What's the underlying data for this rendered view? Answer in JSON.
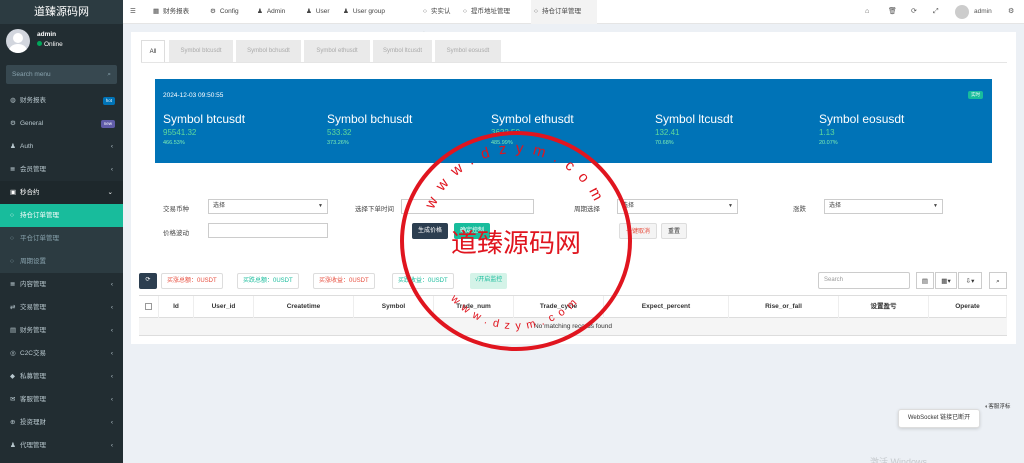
{
  "logo": "道臻源码网",
  "user": {
    "name": "admin",
    "status": "Online"
  },
  "search": {
    "placeholder": "Search menu"
  },
  "menu": [
    {
      "icon": "dashboard-icon",
      "label": "财务报表",
      "badge": "hot",
      "badge_color": "#0073b7",
      "state": "normal"
    },
    {
      "icon": "cogs-icon",
      "label": "General",
      "badge": "new",
      "badge_color": "#605ca8",
      "state": "normal"
    },
    {
      "icon": "group-icon",
      "label": "Auth",
      "arrow": "‹",
      "state": "normal"
    },
    {
      "icon": "list-icon",
      "label": "会员管理",
      "arrow": "‹",
      "state": "normal"
    },
    {
      "icon": "calendar-icon",
      "label": "秒合约",
      "arrow": "⌄",
      "state": "open"
    },
    {
      "icon": "circle-icon",
      "label": "持仓订单管理",
      "state": "active"
    },
    {
      "icon": "circle-icon",
      "label": "平仓订单管理",
      "state": "sub"
    },
    {
      "icon": "circle-icon",
      "label": "周期设置",
      "state": "sub"
    },
    {
      "icon": "list-icon",
      "label": "内容管理",
      "arrow": "‹",
      "state": "normal"
    },
    {
      "icon": "exchange-icon",
      "label": "交易管理",
      "arrow": "‹",
      "state": "normal"
    },
    {
      "icon": "file-icon",
      "label": "财务管理",
      "arrow": "‹",
      "state": "normal"
    },
    {
      "icon": "globe-icon",
      "label": "C2C交易",
      "arrow": "‹",
      "state": "normal"
    },
    {
      "icon": "diamond-icon",
      "label": "私募管理",
      "arrow": "‹",
      "state": "normal"
    },
    {
      "icon": "chat-icon",
      "label": "客服管理",
      "arrow": "‹",
      "state": "normal"
    },
    {
      "icon": "plus-circle-icon",
      "label": "投资理财",
      "arrow": "‹",
      "state": "normal"
    },
    {
      "icon": "users-icon",
      "label": "代理管理",
      "arrow": "‹",
      "state": "normal"
    }
  ],
  "topnav": [
    {
      "icon": "☰",
      "label": ""
    },
    {
      "icon": "▦",
      "label": "财务报表"
    },
    {
      "icon": "⚙",
      "label": "Config"
    },
    {
      "icon": "♟",
      "label": "Admin"
    },
    {
      "icon": "♟",
      "label": "User"
    },
    {
      "icon": "♟",
      "label": "User group"
    },
    {
      "icon": "○",
      "label": "实实认证"
    },
    {
      "icon": "○",
      "label": "提币地址管理"
    },
    {
      "icon": "○",
      "label": "持仓订单管理"
    }
  ],
  "topright": {
    "admin": "admin"
  },
  "tabs": [
    "All",
    "Symbol btcusdt",
    "Symbol bchusdt",
    "Symbol ethusdt",
    "Symbol ltcusdt",
    "Symbol eosusdt"
  ],
  "banner": {
    "date": "2024-12-03 09:50:55",
    "tag": "实时",
    "symbols": [
      {
        "name": "Symbol btcusdt",
        "price": "95541.32",
        "change": "466.53%"
      },
      {
        "name": "Symbol bchusdt",
        "price": "533.32",
        "change": "373.26%"
      },
      {
        "name": "Symbol ethusdt",
        "price": "3623.50",
        "change": "485.99%"
      },
      {
        "name": "Symbol ltcusdt",
        "price": "132.41",
        "change": "70.68%"
      },
      {
        "name": "Symbol eosusdt",
        "price": "1.13",
        "change": "20.07%"
      }
    ]
  },
  "filters": {
    "currency_label": "交易币种",
    "currency_value": "选择",
    "order_time_label": "选择下单时间",
    "period_label": "周期选择",
    "period_value": "选择",
    "rise_fall_label": "涨跌",
    "rise_fall_value": "选择",
    "price_swing_label": "价格波动",
    "btn_generate": "生成价格",
    "btn_control": "确定控制",
    "btn_cancel": "一键取消",
    "btn_reset": "重置"
  },
  "toolbar": {
    "rise_total": "买涨总额：0USDT",
    "fall_total": "买跌总额：0USDT",
    "rise_income": "买涨收益：0USDT",
    "fall_income": "买跌收益：0USDT",
    "monitor": "√开启监控",
    "search_placeholder": "Search"
  },
  "table": {
    "columns": [
      "Id",
      "User_id",
      "Createtime",
      "Symbol",
      "Trade_num",
      "Trade_cycle",
      "Expect_percent",
      "Rise_or_fall",
      "设置盈亏",
      "Operate"
    ],
    "empty": "No matching records found"
  },
  "watermark": {
    "center": "道臻源码网",
    "top_text": "www.dzym.com",
    "bottom_text": "www.dzym.com"
  },
  "toast": "WebSocket 链接已断开",
  "float_label": "客服浮标",
  "activate": "激活 Windows",
  "colors": {
    "primary": "#0073b7",
    "accent": "#18bc9c",
    "danger": "#e74c3c",
    "sidebar": "#222d32",
    "stamp": "#e0151f"
  }
}
